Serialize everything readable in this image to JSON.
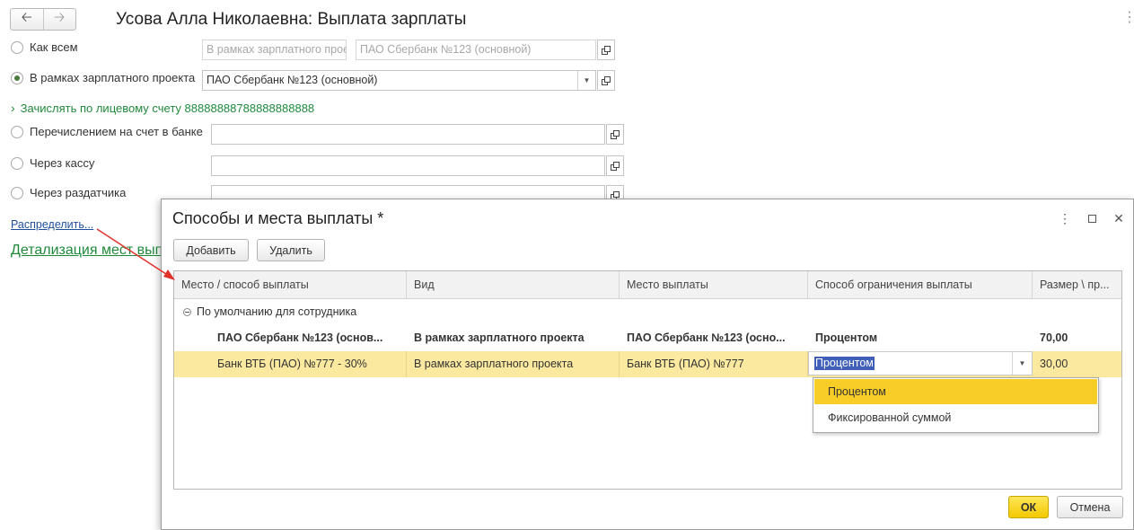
{
  "form": {
    "title": "Усова Алла Николаевна: Выплата зарплаты",
    "options": [
      {
        "label": "Как всем"
      },
      {
        "label": "В рамках зарплатного проекта"
      },
      {
        "label": "Перечислением на счет в банке"
      },
      {
        "label": "Через кассу"
      },
      {
        "label": "Через раздатчика"
      }
    ],
    "like_all_field1": "В рамках зарплатного прое",
    "like_all_field2": "ПАО Сбербанк №123 (основной)",
    "project_field": "ПАО Сбербанк №123 (основной)",
    "account_link": "Зачислять по лицевому счету 88888888788888888888",
    "distribute_link": "Распределить...",
    "details_link": "Детализация мест выплаты"
  },
  "dialog": {
    "title": "Способы и места выплаты *",
    "add_button": "Добавить",
    "delete_button": "Удалить",
    "ok_button": "ОК",
    "cancel_button": "Отмена",
    "columns": [
      "Место / способ выплаты",
      "Вид",
      "Место выплаты",
      "Способ ограничения выплаты",
      "Размер \\ пр..."
    ],
    "group_label": "По умолчанию для сотрудника",
    "rows": [
      [
        "ПАО Сбербанк №123 (основ...",
        "В рамках зарплатного проекта",
        "ПАО Сбербанк №123 (осно...",
        "Процентом",
        "70,00"
      ],
      [
        "Банк ВТБ (ПАО) №777 - 30%",
        "В рамках зарплатного проекта",
        "Банк ВТБ (ПАО) №777",
        "Процентом",
        "30,00"
      ]
    ],
    "dropdown_options": [
      "Процентом",
      "Фиксированной суммой"
    ]
  },
  "colors": {
    "accent_green": "#208a3c",
    "selection": "#fbe9a0",
    "ok_yellow": "#f3c900"
  }
}
